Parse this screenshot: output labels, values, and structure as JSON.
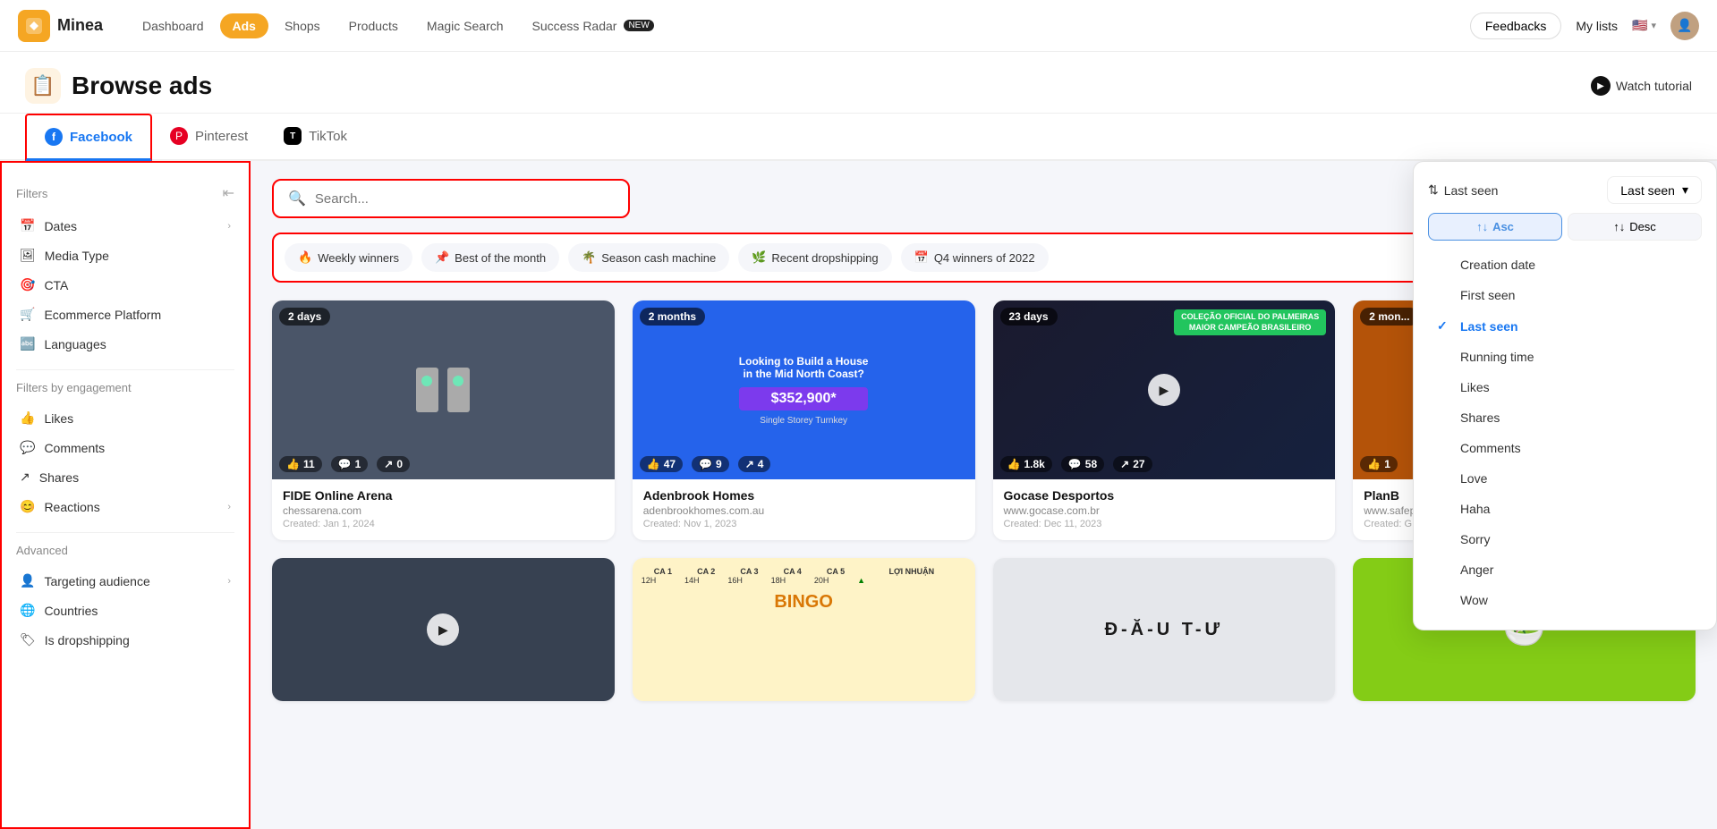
{
  "app": {
    "name": "Minea",
    "logo_emoji": "🟧"
  },
  "topnav": {
    "items": [
      {
        "id": "dashboard",
        "label": "Dashboard",
        "active": false
      },
      {
        "id": "ads",
        "label": "Ads",
        "active": true
      },
      {
        "id": "shops",
        "label": "Shops",
        "active": false
      },
      {
        "id": "products",
        "label": "Products",
        "active": false
      },
      {
        "id": "magic-search",
        "label": "Magic Search",
        "active": false
      },
      {
        "id": "success-radar",
        "label": "Success Radar",
        "active": false,
        "badge": "NEW"
      }
    ],
    "feedbacks_label": "Feedbacks",
    "mylists_label": "My lists",
    "flag": "🇺🇸"
  },
  "page_header": {
    "title": "Browse ads",
    "icon": "📋",
    "watch_tutorial": "Watch tutorial"
  },
  "platform_tabs": [
    {
      "id": "facebook",
      "label": "Facebook",
      "icon_letter": "f",
      "active": true
    },
    {
      "id": "pinterest",
      "label": "Pinterest",
      "icon_letter": "p",
      "active": false
    },
    {
      "id": "tiktok",
      "label": "TikTok",
      "icon_letter": "T",
      "active": false
    }
  ],
  "sidebar": {
    "filters_label": "Filters",
    "collapse_icon": "⇤",
    "basic_filters": [
      {
        "id": "dates",
        "label": "Dates",
        "icon": "📅",
        "has_arrow": true
      },
      {
        "id": "media-type",
        "label": "Media Type",
        "icon": "🖼",
        "has_arrow": false
      },
      {
        "id": "cta",
        "label": "CTA",
        "icon": "🎯",
        "has_arrow": false
      },
      {
        "id": "ecommerce-platform",
        "label": "Ecommerce Platform",
        "icon": "🛒",
        "has_arrow": false
      },
      {
        "id": "languages",
        "label": "Languages",
        "icon": "🔤",
        "has_arrow": false
      }
    ],
    "engagement_label": "Filters by engagement",
    "engagement_filters": [
      {
        "id": "likes",
        "label": "Likes",
        "icon": "👍",
        "has_arrow": false
      },
      {
        "id": "comments",
        "label": "Comments",
        "icon": "💬",
        "has_arrow": false
      },
      {
        "id": "shares",
        "label": "Shares",
        "icon": "↗",
        "has_arrow": false
      },
      {
        "id": "reactions",
        "label": "Reactions",
        "icon": "😊",
        "has_arrow": true
      }
    ],
    "advanced_label": "Advanced",
    "advanced_filters": [
      {
        "id": "targeting-audience",
        "label": "Targeting audience",
        "icon": "👤",
        "has_arrow": true
      },
      {
        "id": "countries",
        "label": "Countries",
        "icon": "🌐",
        "has_arrow": false
      },
      {
        "id": "is-dropshipping",
        "label": "Is dropshipping",
        "icon": "🏷",
        "has_arrow": false
      }
    ]
  },
  "search": {
    "placeholder": "Search..."
  },
  "filter_chips": [
    {
      "id": "weekly-winners",
      "label": "Weekly winners",
      "emoji": "🔥",
      "active": false
    },
    {
      "id": "best-of-month",
      "label": "Best of the month",
      "emoji": "📌",
      "active": false
    },
    {
      "id": "season-cash-machine",
      "label": "Season cash machine",
      "emoji": "🌴",
      "active": false
    },
    {
      "id": "recent-dropshipping",
      "label": "Recent dropshipping",
      "emoji": "🌿",
      "active": false
    },
    {
      "id": "q4-winners",
      "label": "Q4 winners of 2022",
      "emoji": "📅",
      "active": false
    }
  ],
  "sort_dropdown": {
    "sort_label": "Last seen",
    "sort_icon": "⇅",
    "asc_label": "Asc",
    "desc_label": "Desc",
    "active_direction": "asc",
    "options": [
      {
        "id": "creation-date",
        "label": "Creation date",
        "active": false
      },
      {
        "id": "first-seen",
        "label": "First seen",
        "active": false
      },
      {
        "id": "last-seen",
        "label": "Last seen",
        "active": true
      },
      {
        "id": "running-time",
        "label": "Running time",
        "active": false
      },
      {
        "id": "likes",
        "label": "Likes",
        "active": false
      },
      {
        "id": "shares",
        "label": "Shares",
        "active": false
      },
      {
        "id": "comments",
        "label": "Comments",
        "active": false
      },
      {
        "id": "love",
        "label": "Love",
        "active": false
      },
      {
        "id": "haha",
        "label": "Haha",
        "active": false
      },
      {
        "id": "sorry",
        "label": "Sorry",
        "active": false
      },
      {
        "id": "anger",
        "label": "Anger",
        "active": false
      },
      {
        "id": "wow",
        "label": "Wow",
        "active": false
      }
    ]
  },
  "cards": [
    {
      "id": "card-1",
      "title": "FIDE Online Arena",
      "url": "chessarena.com",
      "created": "Created: Jan 1, 2024",
      "badge": "2 days",
      "likes": "11",
      "comments": "1",
      "shares": "0",
      "bg": "#4a5568",
      "has_video": false
    },
    {
      "id": "card-2",
      "title": "Adenbrook Homes",
      "url": "adenbrookhomes.com.au",
      "created": "Created: Nov 1, 2023",
      "badge": "2 months",
      "likes": "47",
      "comments": "9",
      "shares": "4",
      "bg": "#2563eb",
      "has_video": false
    },
    {
      "id": "card-3",
      "title": "Gocase Desportos",
      "url": "www.gocase.com.br",
      "created": "Created: Dec 11, 2023",
      "badge": "23 days",
      "likes": "1.8k",
      "comments": "58",
      "shares": "27",
      "bg": "#111827",
      "has_video": true
    },
    {
      "id": "card-4",
      "title": "PlanB",
      "url": "www.safep...",
      "created": "Created: G...",
      "badge": "2 mon...",
      "likes": "1",
      "comments": "",
      "shares": "",
      "bg": "#b45309",
      "has_video": true
    }
  ],
  "bottom_cards": [
    {
      "id": "bc-1",
      "bg": "#374151",
      "has_video": true
    },
    {
      "id": "bc-2",
      "bg": "#f59e0b",
      "has_video": false
    },
    {
      "id": "bc-3",
      "bg": "#e5e7eb",
      "has_video": false
    },
    {
      "id": "bc-4",
      "bg": "#84cc16",
      "has_video": false
    }
  ]
}
